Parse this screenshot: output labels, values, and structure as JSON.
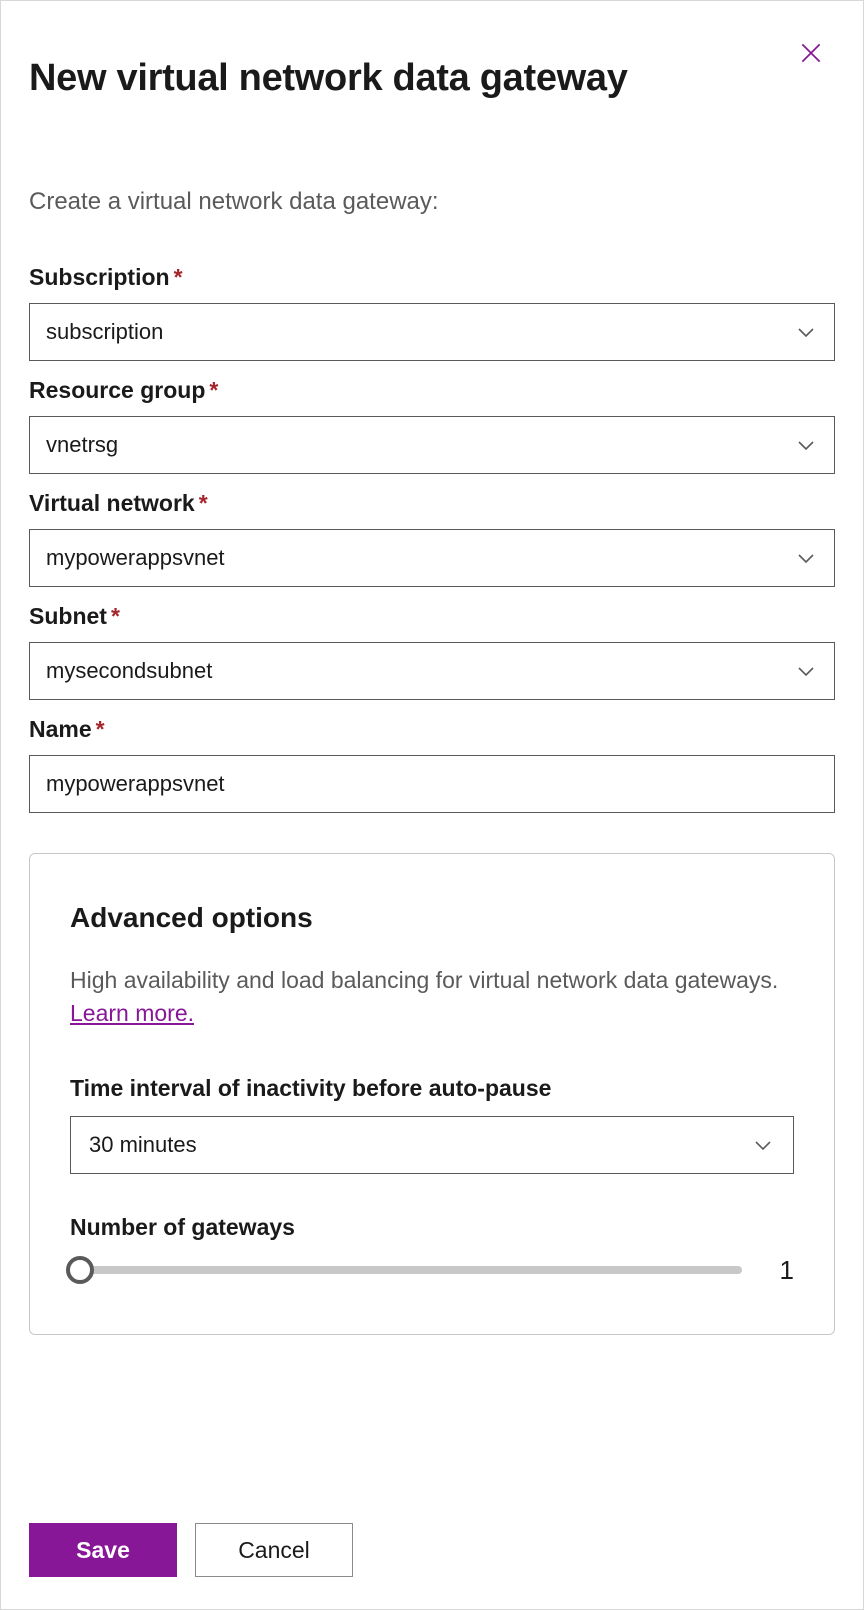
{
  "header": {
    "title": "New virtual network data gateway",
    "subtitle": "Create a virtual network data gateway:"
  },
  "fields": {
    "subscription": {
      "label": "Subscription",
      "value": "subscription"
    },
    "resource_group": {
      "label": "Resource group",
      "value": "vnetrsg"
    },
    "virtual_network": {
      "label": "Virtual network",
      "value": "mypowerappsvnet"
    },
    "subnet": {
      "label": "Subnet",
      "value": "mysecondsubnet"
    },
    "name": {
      "label": "Name",
      "value": "mypowerappsvnet"
    }
  },
  "advanced": {
    "title": "Advanced options",
    "description": "High availability and load balancing for virtual network data gateways. ",
    "learn_more": "Learn more.",
    "time_interval": {
      "label": "Time interval of inactivity before auto-pause",
      "value": "30 minutes"
    },
    "gateways": {
      "label": "Number of gateways",
      "value": "1"
    }
  },
  "footer": {
    "save": "Save",
    "cancel": "Cancel"
  }
}
